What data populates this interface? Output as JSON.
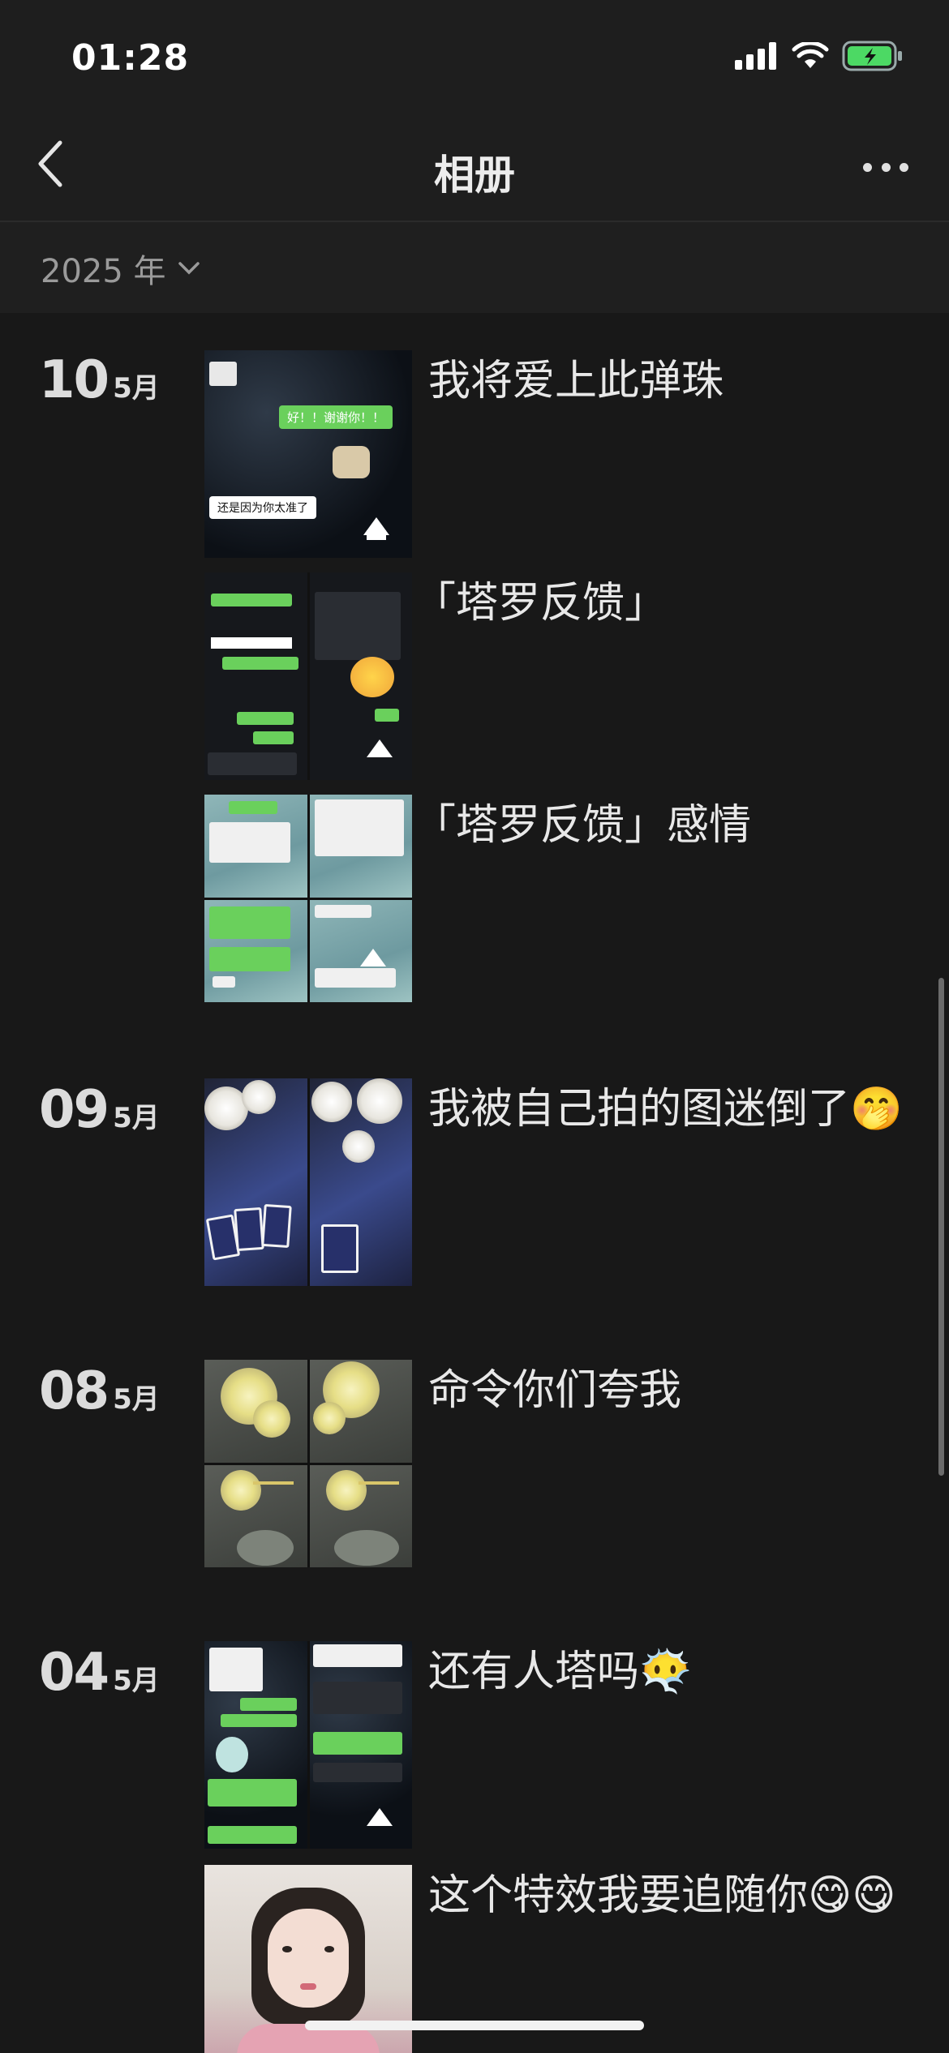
{
  "status": {
    "time": "01:28"
  },
  "nav": {
    "title": "相册"
  },
  "year_filter": {
    "label": "2025 年"
  },
  "entries": [
    {
      "day": "10",
      "month": "5月",
      "captions": [
        "我将爱上此弹珠",
        "「塔罗反馈」",
        "「塔罗反馈」感情"
      ]
    },
    {
      "day": "09",
      "month": "5月",
      "captions": [
        "我被自己拍的图迷倒了🤭"
      ]
    },
    {
      "day": "08",
      "month": "5月",
      "captions": [
        "命令你们夸我"
      ]
    },
    {
      "day": "04",
      "month": "5月",
      "captions": [
        "还有人塔吗😶‍🌫️",
        "这个特效我要追随你😋😋"
      ]
    }
  ],
  "thumbs": {
    "t1_bubble_green": "好！！谢谢你！！",
    "t1_bubble_white": "还是因为你太准了"
  },
  "colors": {
    "background": "#181818",
    "accent_green": "#6ad05c",
    "battery": "#4cd964"
  }
}
